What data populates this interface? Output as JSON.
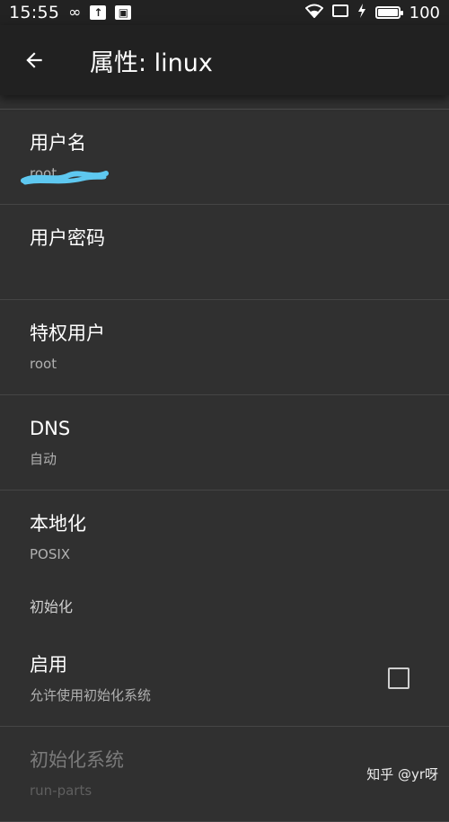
{
  "status_bar": {
    "time": "15:55",
    "icons_left": [
      "infinity-icon",
      "upload-icon",
      "image-notification-icon"
    ],
    "icons_right": [
      "wifi-icon",
      "cast-icon",
      "charging-icon",
      "battery-icon"
    ],
    "battery_level": "100",
    "battery_fill_fraction": 1.0
  },
  "app_bar": {
    "title": "属性: linux",
    "back_icon": "arrow-back-icon"
  },
  "settings": [
    {
      "title": "用户名",
      "value": "root"
    },
    {
      "title": "用户密码",
      "value": ""
    },
    {
      "title": "特权用户",
      "value": "root"
    },
    {
      "title": "DNS",
      "value": "自动"
    },
    {
      "title": "本地化",
      "value": "POSIX"
    }
  ],
  "section_header": "初始化",
  "init_toggle": {
    "title": "启用",
    "subtitle": "允许使用初始化系统",
    "checked": false
  },
  "init_system": {
    "title": "初始化系统",
    "value": "run-parts",
    "enabled": false
  },
  "watermark": "知乎 @yr呀",
  "colors": {
    "background": "#303030",
    "app_bar": "#212121",
    "scribble": "#5ec8f0"
  }
}
